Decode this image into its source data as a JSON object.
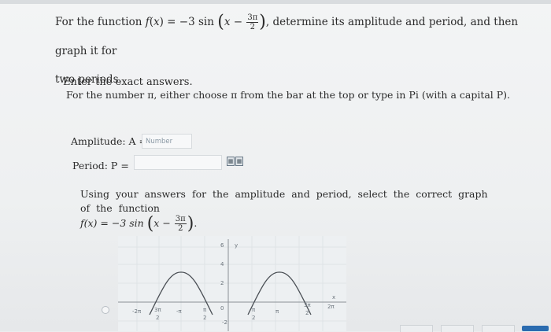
{
  "question": {
    "prefix": "For the function",
    "f": "f",
    "x": "x",
    "eq": ") = −3 sin",
    "inner_x": "x −",
    "frac_num": "3π",
    "frac_den": "2",
    "suffix": ", determine its amplitude and period, and then graph it for",
    "line2": "two periods."
  },
  "instructions": {
    "line1": "Enter the exact answers.",
    "line2": "For the number π, either choose π from the bar at the top or type in Pi (with a capital P)."
  },
  "amplitude": {
    "label": "Amplitude: A =",
    "placeholder": "Number"
  },
  "period": {
    "label": "Period: P ="
  },
  "graph_prompt": {
    "line1": "Using your answers for the amplitude and period, select the correct graph of the function",
    "func": "f(x) = −3 sin",
    "inner_x": "x −",
    "frac_num": "3π",
    "frac_den": "2"
  },
  "graph_labels": {
    "y": "y",
    "x": "x",
    "y6": "6",
    "y4": "4",
    "y2": "2",
    "y0": "0",
    "yneg2": "-2",
    "xneg2pi": "-2π",
    "xneg3pi2_num": "3π",
    "xneg3pi2_den": "2",
    "xnegpi": "-π",
    "xnegpi2_num": "π",
    "xnegpi2_den": "2",
    "xpi2_num": "π",
    "xpi2_den": "2",
    "xpi": "π",
    "x3pi2_num": "3π",
    "x3pi2_den": "2",
    "x2pi": "2π"
  },
  "colors": {
    "accent": "#2b6cb0"
  }
}
